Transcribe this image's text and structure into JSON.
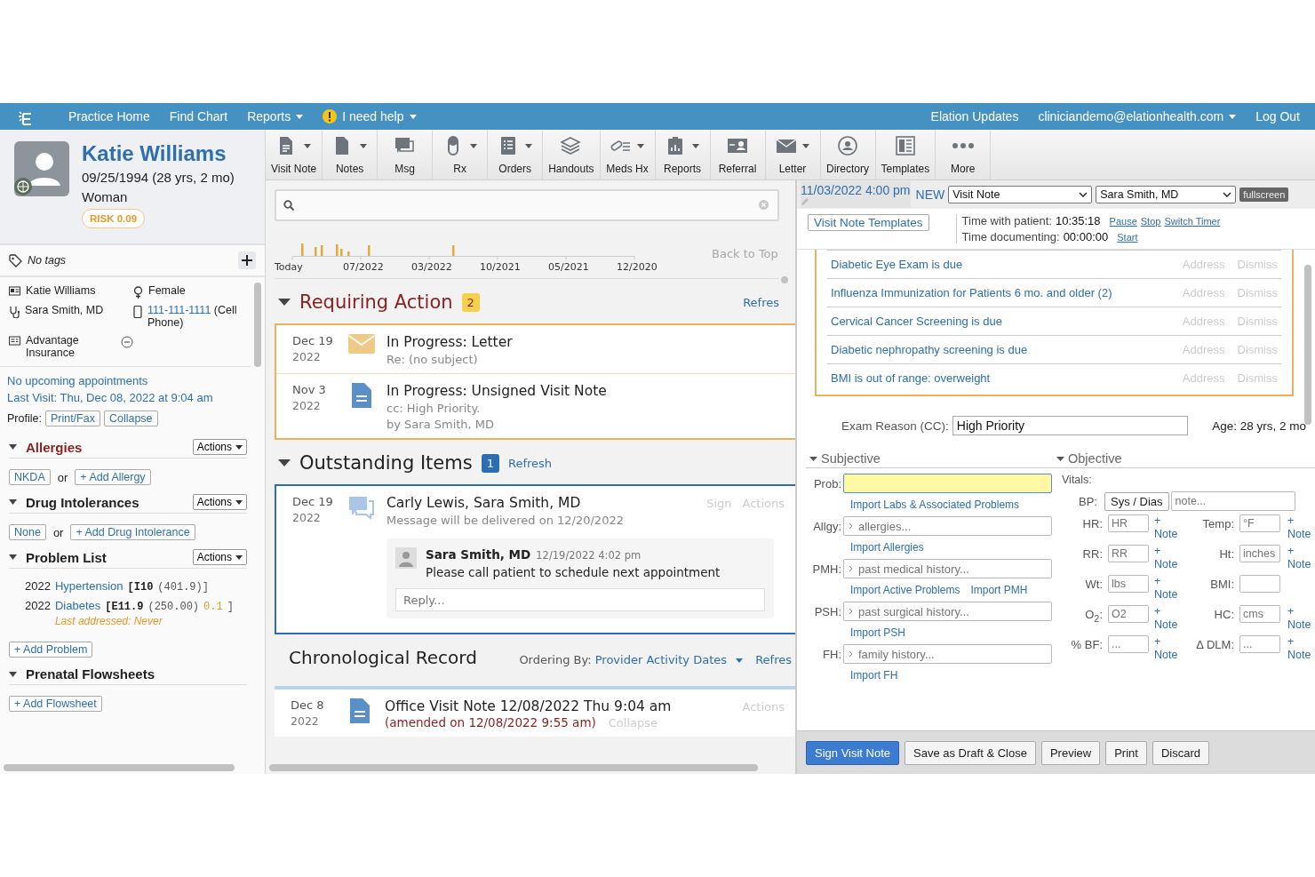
{
  "nav": {
    "items": [
      {
        "label": "Practice Home",
        "dropdown": false,
        "alert": false
      },
      {
        "label": "Find Chart",
        "dropdown": false,
        "alert": false
      },
      {
        "label": "Reports",
        "dropdown": true,
        "alert": false
      },
      {
        "label": "I need help",
        "dropdown": true,
        "alert": true
      }
    ],
    "right": [
      {
        "label": "Elation Updates",
        "dropdown": false
      },
      {
        "label": "cliniciandemo@elationhealth.com",
        "dropdown": true
      },
      {
        "label": "Log Out",
        "dropdown": false
      }
    ]
  },
  "patient": {
    "name": "Katie Williams",
    "dob": "09/25/1994 (28 yrs, 2 mo)",
    "gender_identity": "Woman",
    "risk": "RISK 0.09"
  },
  "tags": {
    "text": "No tags"
  },
  "demographics": {
    "name": "Katie Williams",
    "sex": "Female",
    "provider": "Sara Smith, MD",
    "phone": "111-111-1111",
    "phone_type": "(Cell Phone)",
    "insurance": "Advantage Insurance"
  },
  "appointments": {
    "upcoming": "No upcoming appointments",
    "last_visit": "Last Visit: Thu, Dec 08, 2022 at 9:04 am"
  },
  "profile": {
    "label": "Profile:",
    "buttons": [
      "Print/Fax",
      "Collapse"
    ]
  },
  "sections": [
    {
      "title": "Allergies",
      "alert": true,
      "actions": "Actions",
      "buttons": [
        "NKDA",
        "+ Add Allergy"
      ],
      "separator": "or"
    },
    {
      "title": "Drug Intolerances",
      "alert": false,
      "actions": "Actions",
      "buttons": [
        "None",
        "+ Add Drug Intolerance"
      ],
      "separator": "or"
    },
    {
      "title": "Problem List",
      "alert": false,
      "actions": "Actions",
      "problems": [
        {
          "year": "2022",
          "name": "Hypertension",
          "code": "[I10",
          "icd9": "(401.9)]"
        },
        {
          "year": "2022",
          "name": "Diabetes",
          "code": "[E11.9",
          "icd9": "(250.00)",
          "score": "0.1",
          "close": "]",
          "note": "Last addressed: Never"
        }
      ],
      "buttons": [
        "+ Add Problem"
      ]
    },
    {
      "title": "Prenatal Flowsheets",
      "alert": false,
      "buttons": [
        "+ Add Flowsheet"
      ]
    }
  ],
  "toolbar": [
    {
      "label": "Visit Note",
      "dropdown": true
    },
    {
      "label": "Notes",
      "dropdown": true
    },
    {
      "label": "Msg",
      "dropdown": false
    },
    {
      "label": "Rx",
      "dropdown": true
    },
    {
      "label": "Orders",
      "dropdown": true
    },
    {
      "label": "Handouts",
      "dropdown": false
    },
    {
      "label": "Meds Hx",
      "dropdown": true
    },
    {
      "label": "Reports",
      "dropdown": true
    },
    {
      "label": "Referral",
      "dropdown": false
    },
    {
      "label": "Letter",
      "dropdown": true
    },
    {
      "label": "Directory",
      "dropdown": false
    },
    {
      "label": "Templates",
      "dropdown": false
    },
    {
      "label": "More",
      "dropdown": false
    }
  ],
  "timeline": {
    "labels": [
      "Today",
      "07/2022",
      "03/2022",
      "10/2021",
      "05/2021",
      "12/2020"
    ],
    "back_to_top": "Back to Top"
  },
  "requiring": {
    "title": "Requiring Action",
    "count": "2",
    "refresh": "Refres",
    "kind": "requiring",
    "items": [
      {
        "month": "Dec 19",
        "year": "2022",
        "kind": "letter",
        "title": "In Progress: Letter",
        "lines": [
          "Re: (no subject)"
        ]
      },
      {
        "month": "Nov 3",
        "year": "2022",
        "kind": "note",
        "title": "In Progress: Unsigned Visit Note",
        "lines": [
          "cc: High Priority.",
          "by Sara Smith, MD"
        ]
      }
    ]
  },
  "outstanding": {
    "title": "Outstanding Items",
    "count": "1",
    "refresh": "Refresh",
    "kind": "outstanding",
    "items": [
      {
        "month": "Dec 19",
        "year": "2022",
        "kind": "message",
        "title": "Carly Lewis, Sara Smith, MD",
        "lines": [
          "Message will be delivered on 12/20/2022"
        ],
        "actions": [
          "Sign",
          "Actions"
        ],
        "comment": {
          "author": "Sara Smith, MD",
          "time": "12/19/2022 4:02 pm",
          "text": "Please call patient to schedule next appointment"
        },
        "reply_placeholder": "Reply..."
      }
    ]
  },
  "chronological": {
    "title": "Chronological Record",
    "ordering_label": "Ordering By:",
    "ordering": "Provider Activity Dates",
    "refresh": "Refres",
    "entries": [
      {
        "month": "Dec 8",
        "year": "2022",
        "kind": "note",
        "title": "Office Visit Note 12/08/2022 Thu 9:04 am",
        "amended": "(amended on 12/08/2022 9:55 am)",
        "collapse": "Collapse",
        "actions": [
          "Actions"
        ]
      }
    ]
  },
  "visit_note": {
    "datetime": "11/03/2022 4:00 pm",
    "status": "NEW",
    "note_type": "Visit Note",
    "provider": "Sara Smith, MD",
    "fullscreen": "fullscreen",
    "templates": "Visit Note Templates",
    "timers": [
      {
        "label": "Time with patient:",
        "value": "10:35:18",
        "links": [
          "Pause",
          "Stop",
          "Switch Timer"
        ]
      },
      {
        "label": "Time documenting:",
        "value": "00:00:00",
        "links": [
          "Start"
        ]
      }
    ],
    "reminders": [
      {
        "text": "Diabetic Eye Exam is due",
        "actions": [
          "Address",
          "Dismiss"
        ]
      },
      {
        "text": "Influenza Immunization for Patients 6 mo. and older (2)",
        "actions": [
          "Address",
          "Dismiss"
        ]
      },
      {
        "text": "Cervical Cancer Screening is due",
        "actions": [
          "Address",
          "Dismiss"
        ]
      },
      {
        "text": "Diabetic nephropathy screening is due",
        "actions": [
          "Address",
          "Dismiss"
        ]
      },
      {
        "text": "BMI is out of range: overweight",
        "actions": [
          "Address",
          "Dismiss"
        ]
      }
    ],
    "exam_reason": {
      "label": "Exam Reason (CC):",
      "value": "High Priority"
    },
    "age": "Age: 28 yrs, 2 mo",
    "subjective": {
      "title": "Subjective",
      "fields": [
        {
          "label": "Prob:",
          "highlighted": true,
          "links": [
            "Import Labs & Associated Problems"
          ]
        },
        {
          "label": "Allgy:",
          "placeholder": "allergies...",
          "highlighted": false,
          "links": [
            "Import Allergies"
          ]
        },
        {
          "label": "PMH:",
          "placeholder": "past medical history...",
          "highlighted": false,
          "links": [
            "Import Active Problems",
            "Import PMH"
          ]
        },
        {
          "label": "PSH:",
          "placeholder": "past surgical history...",
          "highlighted": false,
          "links": [
            "Import PSH"
          ]
        },
        {
          "label": "FH:",
          "placeholder": "family history...",
          "highlighted": false,
          "links": [
            "Import FH"
          ]
        }
      ]
    },
    "objective": {
      "title": "Objective",
      "vitals_label": "Vitals:",
      "bp": {
        "label": "BP:",
        "button": "Sys / Dias",
        "placeholder": "note..."
      },
      "vitals": [
        {
          "label": "HR:",
          "placeholder": "HR",
          "note": "+ Note"
        },
        {
          "label": "Temp:",
          "placeholder": "°F",
          "note": "+ Note"
        },
        {
          "label": "RR:",
          "placeholder": "RR",
          "note": "+ Note"
        },
        {
          "label": "Ht:",
          "placeholder": "inches",
          "note": "+ Note"
        },
        {
          "label": "Wt:",
          "placeholder": "lbs",
          "note": "+ Note"
        },
        {
          "label": "BMI:"
        },
        {
          "label": "O$_{2}$:",
          "placeholder": "O2",
          "note": "+ Note"
        },
        {
          "label": "HC:",
          "placeholder": "cms",
          "note": "+ Note"
        },
        {
          "label": "% BF:",
          "placeholder": "...",
          "note": "+ Note"
        },
        {
          "label": "Δ DLM:",
          "placeholder": "...",
          "note": "+ Note"
        }
      ]
    },
    "footer": [
      {
        "label": "Sign Visit Note",
        "primary": true
      },
      {
        "label": "Save as Draft & Close",
        "primary": false
      },
      {
        "label": "Preview",
        "primary": false
      },
      {
        "label": "Print",
        "primary": false
      },
      {
        "label": "Discard",
        "primary": false
      }
    ]
  }
}
